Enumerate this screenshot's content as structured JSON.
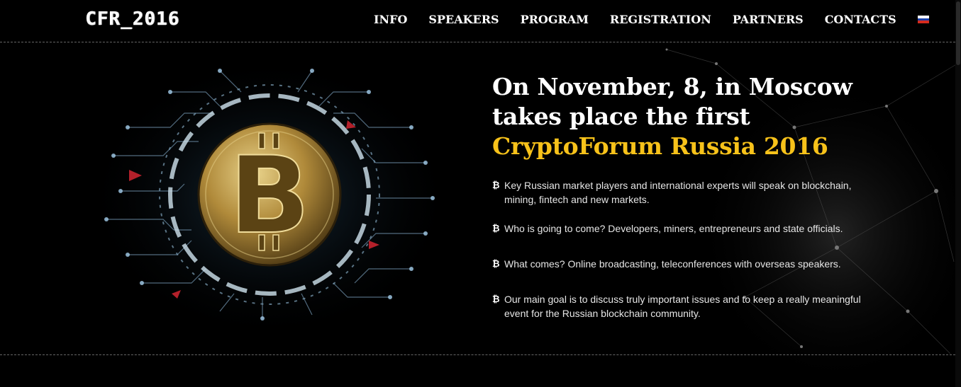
{
  "header": {
    "logo": "CFR_2016",
    "nav": [
      "INFO",
      "SPEAKERS",
      "PROGRAM",
      "REGISTRATION",
      "PARTNERS",
      "CONTACTS"
    ],
    "language_flag": "russia-flag"
  },
  "hero": {
    "title_line1": "On November, 8, in Moscow",
    "title_line2": "takes place the first",
    "title_accent": "CryptoForum Russia 2016",
    "bullet_icon": "₿",
    "bullets": [
      "Key Russian market players and international experts will speak on blockchain, mining, fintech and new markets.",
      "Who is going to come? Developers, miners, entrepreneurs and state officials.",
      "What comes? Online broadcasting, teleconferences with overseas speakers.",
      "Our main goal is to discuss truly important issues and to keep a really meaningful event for the Russian blockchain community."
    ]
  },
  "colors": {
    "background": "#000000",
    "accent": "#f7c21a",
    "text": "#ffffff"
  }
}
